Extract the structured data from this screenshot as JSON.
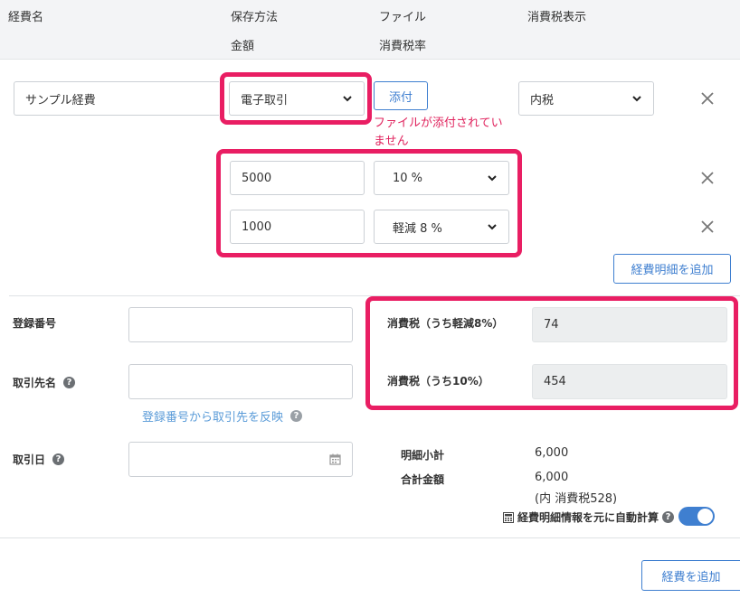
{
  "header": {
    "col_name": "経費名",
    "col_storage": "保存方法",
    "col_amount": "金額",
    "col_file": "ファイル",
    "col_tax_rate": "消費税率",
    "col_tax_display": "消費税表示"
  },
  "expense": {
    "name_value": "サンプル経費",
    "storage_value": "電子取引",
    "attach_label": "添付",
    "file_error": "ファイルが添付されていません",
    "tax_display_value": "内税",
    "lines": [
      {
        "amount": "5000",
        "tax_rate": "10 %"
      },
      {
        "amount": "1000",
        "tax_rate": "軽減 8 %"
      }
    ],
    "add_line_label": "経費明細を追加"
  },
  "details": {
    "registration_label": "登録番号",
    "registration_value": "",
    "partner_label": "取引先名",
    "partner_value": "",
    "reflect_link": "登録番号から取引先を反映",
    "date_label": "取引日",
    "date_value": ""
  },
  "tax": {
    "reduced_label": "消費税（うち軽減8%）",
    "reduced_value": "74",
    "standard_label": "消費税（うち10%）",
    "standard_value": "454"
  },
  "summary": {
    "subtotal_label": "明細小計",
    "subtotal_value": "6,000",
    "total_label": "合計金額",
    "total_value": "6,000",
    "total_tax_note": "(内 消費税528)",
    "auto_calc_label": "経費明細情報を元に自動計算",
    "auto_calc_on": true
  },
  "footer": {
    "add_expense_label": "経費を追加"
  },
  "colors": {
    "accent": "#3f7fd0",
    "highlight": "#e91e63",
    "error": "#e0245e"
  },
  "icons": [
    "chevron-down-icon",
    "close-icon",
    "calendar-icon",
    "help-icon",
    "calculator-icon"
  ]
}
